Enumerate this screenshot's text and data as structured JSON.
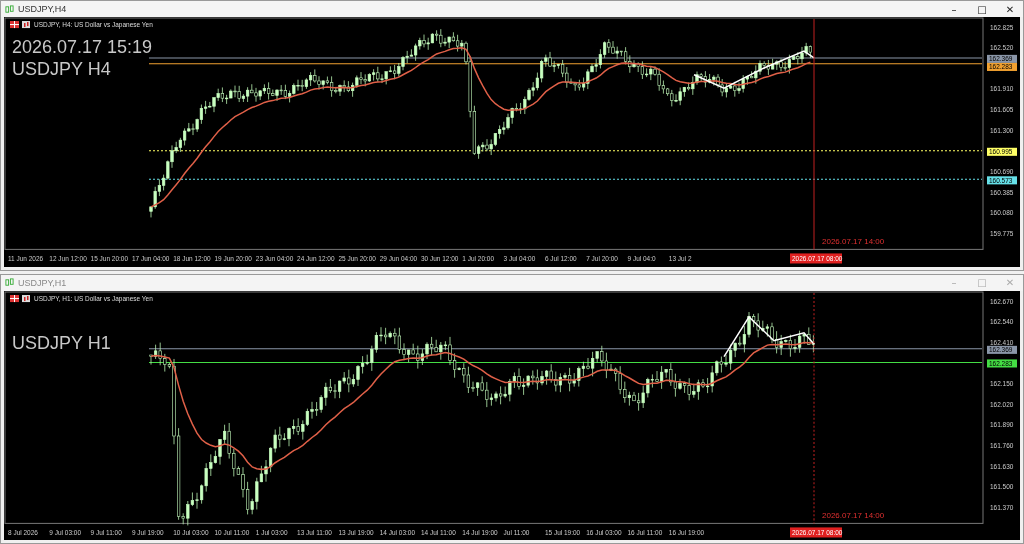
{
  "windows": [
    {
      "title": "USDJPY,H4",
      "active": true,
      "controls": [
        "–",
        "□",
        "✕"
      ],
      "header": "USDJPY, H4: US Dollar vs Japanese Yen",
      "overlays": [
        "2026.07.17 15:19",
        "USDJPY H4"
      ],
      "price_labels": [
        {
          "text": "162.825",
          "kind": "tick"
        },
        {
          "text": "162.520",
          "kind": "tick"
        },
        {
          "text": "162.369",
          "kind": "badge",
          "color": "#8a96a8"
        },
        {
          "text": "162.283",
          "kind": "badge",
          "color": "#f0a030"
        },
        {
          "text": "161.910",
          "kind": "tick"
        },
        {
          "text": "161.605",
          "kind": "tick"
        },
        {
          "text": "161.300",
          "kind": "tick"
        },
        {
          "text": "160.995",
          "kind": "badge",
          "color": "#ffff66"
        },
        {
          "text": "160.690",
          "kind": "tick"
        },
        {
          "text": "160.573",
          "kind": "badge",
          "color": "#66e0e8"
        },
        {
          "text": "160.385",
          "kind": "tick"
        },
        {
          "text": "160.080",
          "kind": "tick"
        },
        {
          "text": "159.775",
          "kind": "tick"
        }
      ],
      "time_labels": [
        "11 Jun 2026",
        "12 Jun 12:00",
        "15 Jun 20:00",
        "17 Jun 04:00",
        "18 Jun 12:00",
        "19 Jun 20:00",
        "23 Jun 04:00",
        "24 Jun 12:00",
        "25 Jun 20:00",
        "29 Jun 04:00",
        "30 Jun 12:00",
        "1 Jul 20:00",
        "3 Jul 04:00",
        "6 Jul 12:00",
        "7 Jul 20:00",
        "9 Jul 04:0",
        "13 Jul 2"
      ],
      "time_badge": "2026.07.17 08:00",
      "marker_label": "2026.07.17 14:00"
    },
    {
      "title": "USDJPY,H1",
      "active": false,
      "controls": [
        "–",
        "□",
        "✕"
      ],
      "header": "USDJPY, H1: US Dollar vs Japanese Yen",
      "overlays": [
        "USDJPY H1"
      ],
      "price_labels": [
        {
          "text": "162.670",
          "kind": "tick"
        },
        {
          "text": "162.540",
          "kind": "tick"
        },
        {
          "text": "162.410",
          "kind": "tick"
        },
        {
          "text": "162.369",
          "kind": "badge",
          "color": "#8a96a8"
        },
        {
          "text": "162.283",
          "kind": "badge",
          "color": "#44dd44"
        },
        {
          "text": "162.150",
          "kind": "tick"
        },
        {
          "text": "162.020",
          "kind": "tick"
        },
        {
          "text": "161.890",
          "kind": "tick"
        },
        {
          "text": "161.760",
          "kind": "tick"
        },
        {
          "text": "161.630",
          "kind": "tick"
        },
        {
          "text": "161.500",
          "kind": "tick"
        },
        {
          "text": "161.370",
          "kind": "tick"
        }
      ],
      "time_labels": [
        "8 Jul 2026",
        "9 Jul 03:00",
        "9 Jul 11:00",
        "9 Jul 19:00",
        "10 Jul 03:00",
        "10 Jul 11:00",
        "1 Jul 03:00",
        "13 Jul 11:00",
        "13 Jul 19:00",
        "14 Jul 03:00",
        "14 Jul 11:00",
        "14 Jul 19:00",
        "Jul 11:00",
        "15 Jul 19:00",
        "16 Jul 03:00",
        "16 Jul 11:00",
        "16 Jul 19:00"
      ],
      "time_badge": "2026.07.17 08:00",
      "marker_label": "2026.07.17 14:00"
    }
  ]
}
